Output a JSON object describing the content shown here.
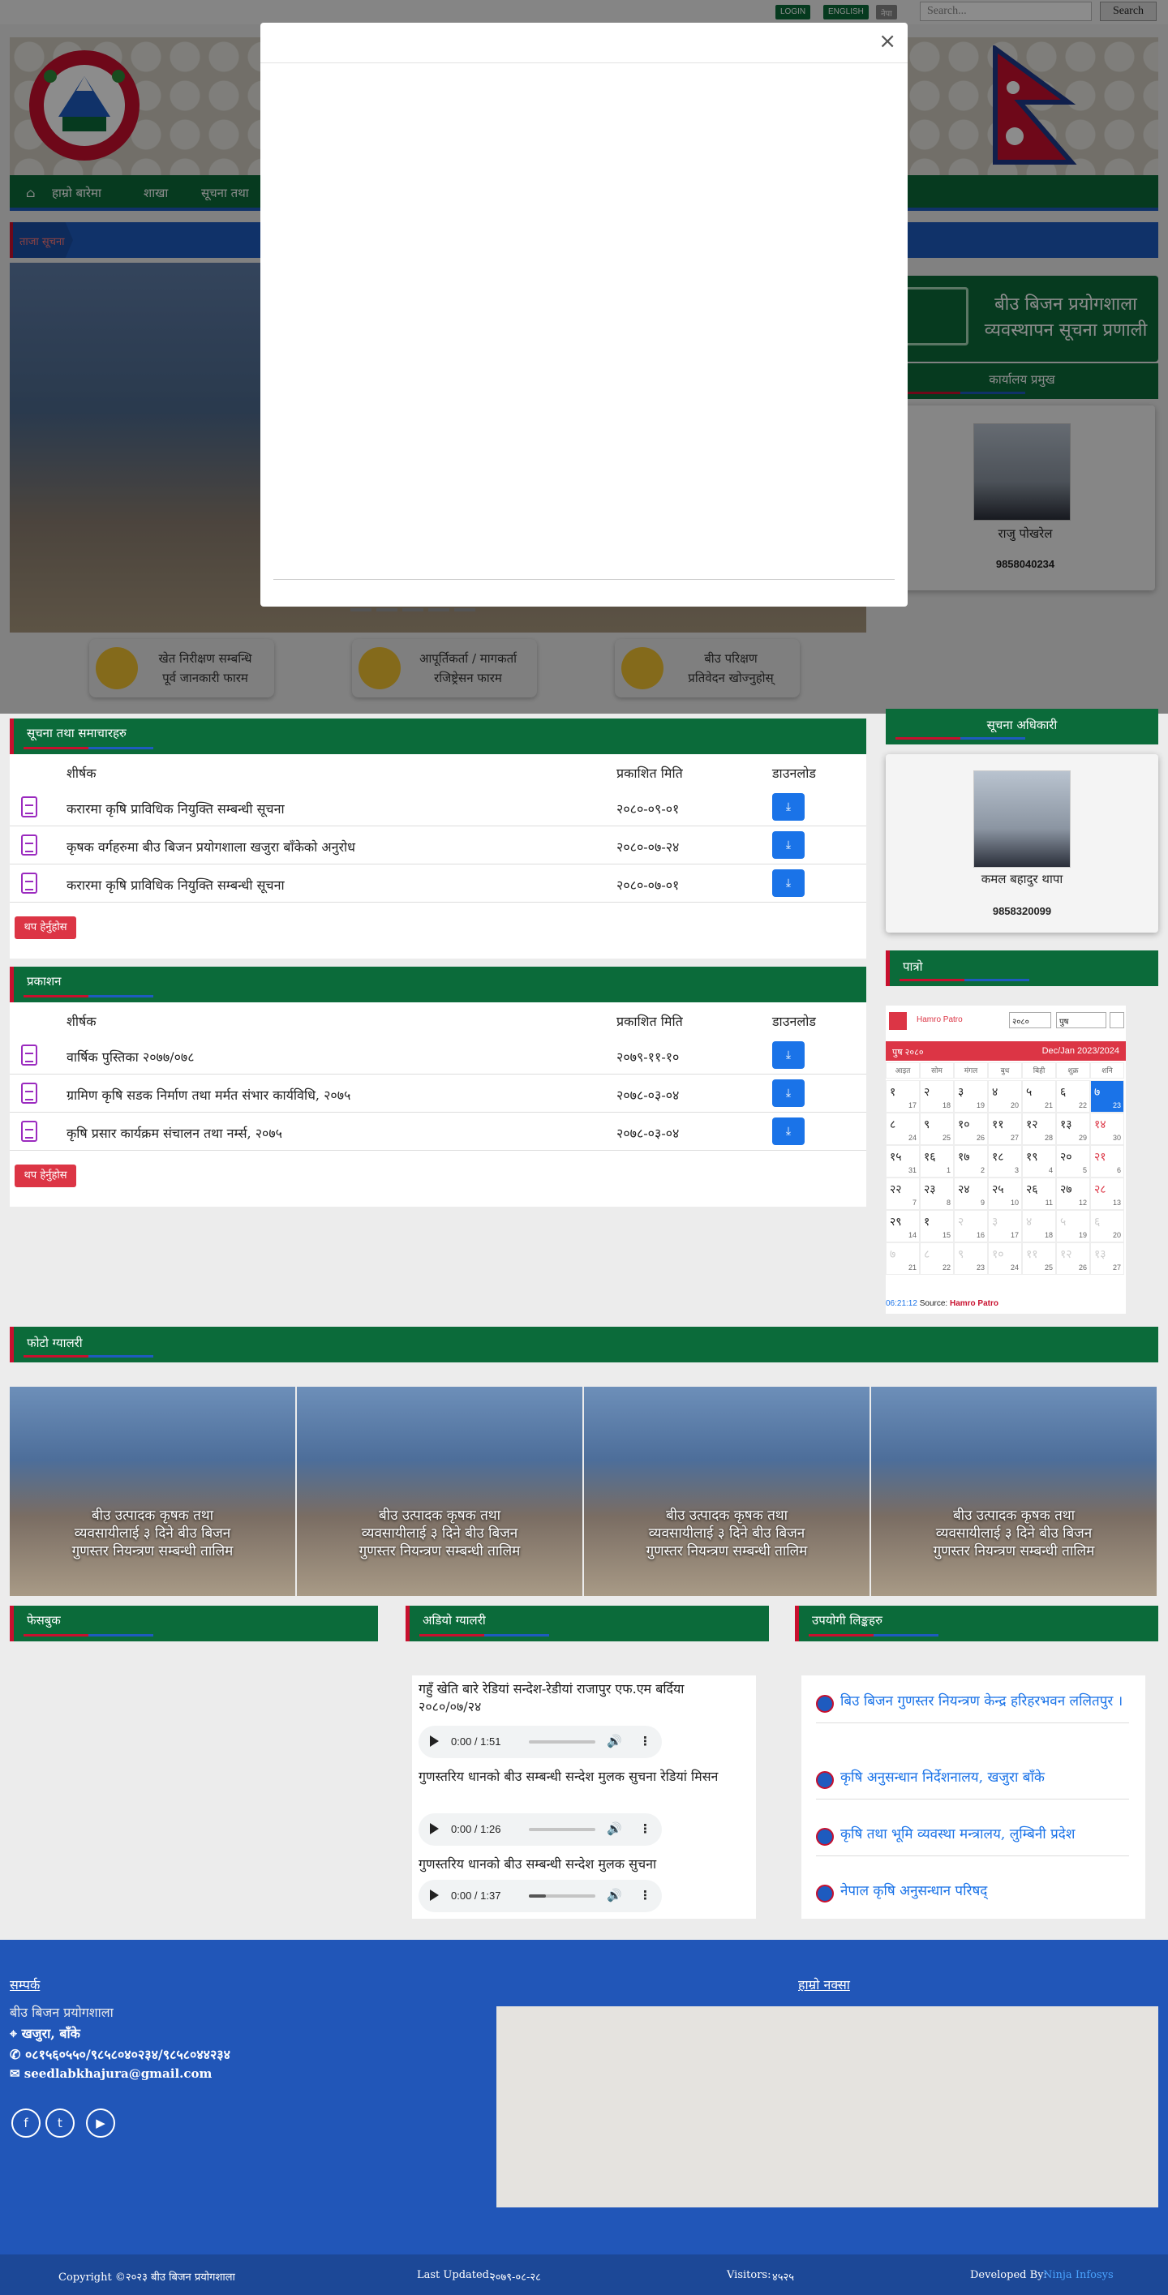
{
  "topbar": {
    "login": "LOGIN",
    "english": "ENGLISH",
    "nepali": "नेपा",
    "search_placeholder": "Search...",
    "search_btn": "Search"
  },
  "nav": {
    "items": [
      "हाम्रो बारेमा",
      "शाखा",
      "सूचना तथा"
    ]
  },
  "ticker": {
    "label": "ताजा सूचना"
  },
  "mis_banner": {
    "line1": "बीउ बिजन प्रयोगशाला",
    "line2": "व्यवस्थापन सूचना प्रणाली"
  },
  "office_head": {
    "heading": "कार्यालय प्रमुख",
    "name": "राजु पोखरेल",
    "phone": "9858040234"
  },
  "info_officer": {
    "heading": "सूचना अधिकारी",
    "name": "कमल बहादुर थापा",
    "phone": "9858320099"
  },
  "quick_links": [
    {
      "text": "खेत निरीक्षण सम्बन्धि पूर्व जानकारी फारम",
      "line1": "खेत निरीक्षण सम्बन्धि",
      "line2": "पूर्व जानकारी फारम"
    },
    {
      "text": "आपूर्तिकर्ता / मागकर्ता रजिष्ट्रेसन फारम",
      "line1": "आपूर्तिकर्ता / मागकर्ता",
      "line2": "रजिष्ट्रेसन फारम"
    },
    {
      "text": "बीउ परिक्षण प्रतिवेदन खोज्नुहोस्",
      "line1": "बीउ परिक्षण",
      "line2": "प्रतिवेदन खोज्नुहोस्"
    }
  ],
  "news": {
    "heading": "सूचना तथा समाचारहरु",
    "col_title": "शीर्षक",
    "col_date": "प्रकाशित मिति",
    "col_download": "डाउनलोड",
    "rows": [
      {
        "title": "करारमा कृषि प्राविधिक नियुक्ति सम्बन्धी सूचना",
        "date": "२०८०-०९-०१"
      },
      {
        "title": "कृषक वर्गहरुमा बीउ बिजन प्रयोगशाला खजुरा बाँकेको अनुरोध",
        "date": "२०८०-०७-२४"
      },
      {
        "title": "करारमा कृषि प्राविधिक नियुक्ति सम्बन्धी सूचना",
        "date": "२०८०-०७-०१"
      }
    ],
    "more": "थप हेर्नुहोस"
  },
  "publications": {
    "heading": "प्रकाशन",
    "col_title": "शीर्षक",
    "col_date": "प्रकाशित मिति",
    "col_download": "डाउनलोड",
    "rows": [
      {
        "title": "वार्षिक पुस्तिका २०७७/०७८",
        "date": "२०७९-११-१०"
      },
      {
        "title": "ग्रामिण कृषि सडक निर्माण तथा मर्मत संभार कार्यविधि, २०७५",
        "date": "२०७८-०३-०४"
      },
      {
        "title": "कृषि प्रसार कार्यक्रम संचालन तथा नर्म्स, २०७५",
        "date": "२०७८-०३-०४"
      }
    ],
    "more": "थप हेर्नुहोस"
  },
  "patro": {
    "heading": "पात्रो",
    "brand": "Hamro Patro",
    "year_select": "२०८०",
    "month_select": "पुष",
    "month_label": "पुष २०८०",
    "eng_label": "Dec/Jan 2023/2024",
    "weekdays": [
      "आइत",
      "सोम",
      "मंगल",
      "बुध",
      "बिही",
      "शुक्र",
      "शनि"
    ],
    "time": "06:21:12",
    "source_label": "Source:",
    "source_link": "Hamro Patro",
    "days": [
      [
        "१",
        "17"
      ],
      [
        "२",
        "18"
      ],
      [
        "३",
        "19"
      ],
      [
        "४",
        "20"
      ],
      [
        "५",
        "21"
      ],
      [
        "६",
        "22"
      ],
      [
        "७",
        "23"
      ],
      [
        "८",
        "24"
      ],
      [
        "९",
        "25"
      ],
      [
        "१०",
        "26"
      ],
      [
        "११",
        "27"
      ],
      [
        "१२",
        "28"
      ],
      [
        "१३",
        "29"
      ],
      [
        "१४",
        "30"
      ],
      [
        "१५",
        "31"
      ],
      [
        "१६",
        "1"
      ],
      [
        "१७",
        "2"
      ],
      [
        "१८",
        "3"
      ],
      [
        "१९",
        "4"
      ],
      [
        "२०",
        "5"
      ],
      [
        "२१",
        "6"
      ],
      [
        "२२",
        "7"
      ],
      [
        "२३",
        "8"
      ],
      [
        "२४",
        "9"
      ],
      [
        "२५",
        "10"
      ],
      [
        "२६",
        "11"
      ],
      [
        "२७",
        "12"
      ],
      [
        "२८",
        "13"
      ],
      [
        "२९",
        "14"
      ],
      [
        "१",
        "15"
      ],
      [
        "२",
        "16"
      ],
      [
        "३",
        "17"
      ],
      [
        "४",
        "18"
      ],
      [
        "५",
        "19"
      ],
      [
        "६",
        "20"
      ],
      [
        "७",
        "21"
      ],
      [
        "८",
        "22"
      ],
      [
        "९",
        "23"
      ],
      [
        "१०",
        "24"
      ],
      [
        "११",
        "25"
      ],
      [
        "१२",
        "26"
      ],
      [
        "१३",
        "27"
      ]
    ]
  },
  "gallery": {
    "heading": "फोटो ग्यालरी",
    "caption": "बीउ उत्पादक कृषक तथा व्यवसायीलाई ३ दिने बीउ बिजन गुणस्तर नियन्त्रण सम्बन्धी तालिम",
    "cap_line1": "बीउ उत्पादक कृषक तथा",
    "cap_line2": "व्यवसायीलाई ३ दिने बीउ बिजन",
    "cap_line3": "गुणस्तर नियन्त्रण सम्बन्धी तालिम"
  },
  "sections": {
    "facebook": "फेसबुक",
    "audio": "अडियो ग्यालरी",
    "links": "उपयोगी लिङ्कहरु"
  },
  "audio": [
    {
      "title": "गहुँ खेति बारे रेडियां सन्देश-रेडीयां राजापुर एफ.एम बर्दिया २०८०/०७/२४",
      "time": "0:00 / 1:51",
      "progress": 0
    },
    {
      "title": "गुणस्तरिय धानको बीउ सम्बन्धी सन्देश मुलक सुचना रेडियां मिसन",
      "time": "0:00 / 1:26",
      "progress": 0
    },
    {
      "title": "गुणस्तरिय धानको बीउ सम्बन्धी सन्देश मुलक सुचना",
      "time": "0:00 / 1:37",
      "progress": 0.25
    }
  ],
  "useful_links": [
    "बिउ बिजन गुणस्तर नियन्त्रण केन्द्र हरिहरभवन ललितपुर ।",
    "कृषि अनुसन्धान निर्देशनालय, खजुरा बाँके",
    "कृषि तथा भूमि व्यवस्था मन्त्रालय, लुम्बिनी प्रदेश",
    "नेपाल कृषि अनुसन्धान परिषद्"
  ],
  "footer": {
    "contact_heading": "सम्पर्क",
    "org": "बीउ बिजन प्रयोगशाला",
    "address": "खजुरा, बाँके",
    "phone": "०८१५६०५५०/९८५८०४०२३४/९८५८०४४२३४",
    "email": "seedlabkhajura@gmail.com",
    "map_heading": "हाम्रो नक्सा",
    "copyright": "Copyright ©२०२३ बीउ बिजन प्रयोगशाला",
    "updated_label": "Last Updated:",
    "updated_value": "२०७९-०८-२८",
    "visitors_label": "Visitors:",
    "visitors_value": "४५२५",
    "dev_label": "Developed By:",
    "dev_value": "Ninja Infosys"
  }
}
